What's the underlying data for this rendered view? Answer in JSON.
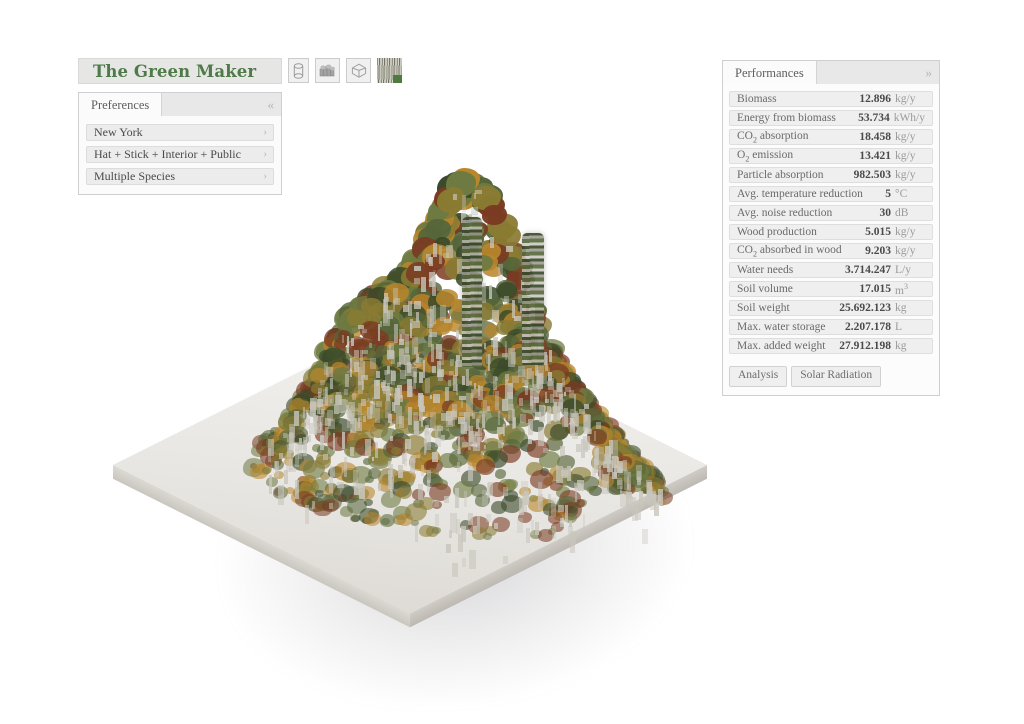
{
  "app": {
    "title": "The Green Maker",
    "title_color": "#4f7a4a"
  },
  "toolbar": {
    "buttons": [
      {
        "name": "extrude-volume-icon",
        "label": ""
      },
      {
        "name": "cluster-massing-icon",
        "label": ""
      },
      {
        "name": "sphere-wireframe-icon",
        "label": ""
      },
      {
        "name": "texture-thumbnail-icon",
        "label": ""
      }
    ]
  },
  "preferences": {
    "tab_label": "Preferences",
    "collapse_icon": "«",
    "row_chevron": "›",
    "items": [
      {
        "label": "New York"
      },
      {
        "label": "Hat + Stick + Interior + Public"
      },
      {
        "label": "Multiple Species"
      }
    ]
  },
  "performances": {
    "tab_label": "Performances",
    "expand_icon": "»",
    "rows": [
      {
        "label": "Biomass",
        "sub": "",
        "value": "12.896",
        "unit": "kg/y"
      },
      {
        "label": "Energy from biomass",
        "sub": "",
        "value": "53.734",
        "unit": "kWh/y"
      },
      {
        "label": "CO",
        "sub": "2",
        "label_tail": " absorption",
        "value": "18.458",
        "unit": "kg/y"
      },
      {
        "label": "O",
        "sub": "2",
        "label_tail": " emission",
        "value": "13.421",
        "unit": "kg/y"
      },
      {
        "label": "Particle absorption",
        "sub": "",
        "value": "982.503",
        "unit": "kg/y"
      },
      {
        "label": "Avg. temperature reduction",
        "sub": "",
        "value": "5",
        "unit": "°C"
      },
      {
        "label": "Avg. noise reduction",
        "sub": "",
        "value": "30",
        "unit": "dB"
      },
      {
        "label": "Wood production",
        "sub": "",
        "value": "5.015",
        "unit": "kg/y"
      },
      {
        "label": "CO",
        "sub": "2",
        "label_tail": " absorbed in wood",
        "value": "9.203",
        "unit": "kg/y"
      },
      {
        "label": "Water needs",
        "sub": "",
        "value": "3.714.247",
        "unit": "L/y"
      },
      {
        "label": "Soil volume",
        "sub": "",
        "value": "17.015",
        "unit": "m",
        "unit_sup": "3"
      },
      {
        "label": "Soil weight",
        "sub": "",
        "value": "25.692.123",
        "unit": "kg"
      },
      {
        "label": "Max. water storage",
        "sub": "",
        "value": "2.207.178",
        "unit": "L"
      },
      {
        "label": "Max. added weight",
        "sub": "",
        "value": "27.912.198",
        "unit": "kg"
      }
    ],
    "actions": [
      {
        "label": "Analysis"
      },
      {
        "label": "Solar Radiation"
      }
    ]
  },
  "viewport": {
    "description": "isometric-3d-vegetated-city-block",
    "background": "#ffffff",
    "base_color": "#e9e7e3",
    "foliage_colors": [
      "#3a4a2a",
      "#56663a",
      "#6d7a42",
      "#8a7b33",
      "#b8862c",
      "#7a3b22"
    ],
    "structure_color": "#c8c6bc"
  }
}
